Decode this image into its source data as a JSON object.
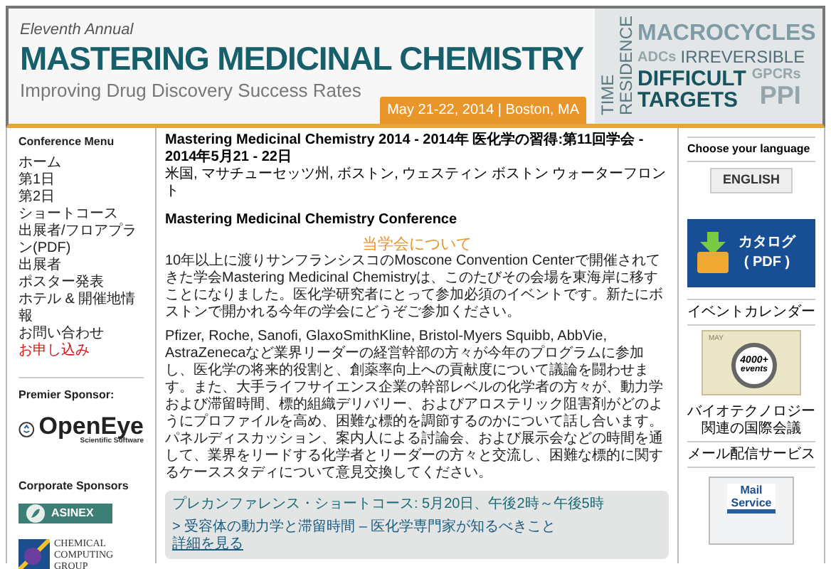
{
  "header": {
    "kicker": "Eleventh Annual",
    "title": "MASTERING MEDICINAL CHEMISTRY",
    "subtitle": "Improving Drug Discovery Success Rates",
    "date": "May 21-22, 2014 | Boston, MA",
    "vertical_words": [
      "RESIDENCE",
      "TIME"
    ],
    "tags": [
      {
        "text": "MACROCYCLES",
        "kind": "large"
      },
      {
        "text": "ADCs",
        "kind": "faint"
      },
      {
        "text": "IRREVERSIBLE",
        "kind": "medium"
      },
      {
        "text": "DIFFICULT",
        "kind": "dark"
      },
      {
        "text": "GPCRs",
        "kind": "faint"
      },
      {
        "text": "TARGETS",
        "kind": "dark"
      },
      {
        "text": "PPI",
        "kind": "faintlarge"
      }
    ]
  },
  "menu": {
    "title": "Conference Menu",
    "items": [
      {
        "label": "ホーム",
        "highlight": false
      },
      {
        "label": "第1日",
        "highlight": false
      },
      {
        "label": "第2日",
        "highlight": false
      },
      {
        "label": "ショートコース",
        "highlight": false
      },
      {
        "label": "出展者/フロアプラン(PDF)",
        "highlight": false
      },
      {
        "label": "出展者",
        "highlight": false
      },
      {
        "label": "ポスター発表",
        "highlight": false
      },
      {
        "label": "ホテル & 開催地情報",
        "highlight": false
      },
      {
        "label": "お問い合わせ",
        "highlight": false
      },
      {
        "label": "お申し込み",
        "highlight": true
      }
    ]
  },
  "premier_sponsor": {
    "title": "Premier Sponsor:",
    "logo": {
      "name": "OpenEye",
      "tagline": "Scientific Software"
    }
  },
  "corporate_sponsors": {
    "title": "Corporate Sponsors",
    "logos": [
      {
        "name": "ASINEX",
        "kind": "asinex"
      },
      {
        "name": "CHEMICAL COMPUTING GROUP",
        "kind": "ccg"
      }
    ]
  },
  "main": {
    "heading_line1": "Mastering Medicinal Chemistry 2014 - 2014年 医化学の習得:第11回学会 -",
    "heading_line2": "2014年5月21 - 22日",
    "venue": "米国, マサチューセッツ州, ボストン, ウェスティン ボストン ウォーターフロント",
    "conference": "Mastering Medicinal Chemistry Conference",
    "about_title": "当学会について",
    "paragraphs": [
      "10年以上に渡りサンフランシスコのMoscone Convention Centerで開催されてきた学会Mastering Medicinal Chemistryは、このたびその会場を東海岸に移すことになりました。医化学研究者にとって参加必須のイベントです。新たにボストンで開かれる今年の学会にどうぞご参加ください。",
      "Pfizer, Roche, Sanofi, GlaxoSmithKline, Bristol-Myers Squibb, AbbVie, AstraZenecaなど業界リーダーの経営幹部の方々が今年のプログラムに参加し、医化学の将来的役割と、創薬率向上への貢献度について議論を闘わせます。また、大手ライフサイエンス企業の幹部レベルの化学者の方々が、動力学および滞留時間、標的組織デリバリー、およびアロステリック阻害剤がどのようにプロファイルを高め、困難な標的を調節するのかについて話し合います。パネルディスカッション、案内人による討論会、および展示会などの時間を通して、業界をリードする化学者とリーダーの方々と交流し、困難な標的に関するケーススタディについて意見交換してください。"
    ],
    "short_course": {
      "title": "プレカンファレンス・ショートコース: 5月20日、午後2時～午後5時",
      "item": "> 受容体の動力学と滞留時間 – 医化学専門家が知るべきこと",
      "link": "詳細を見る"
    }
  },
  "right": {
    "language_title": "Choose your language",
    "language_button": "ENGLISH",
    "catalog_button": {
      "line1": "カタログ",
      "line2": "( PDF )"
    },
    "calendar_title": "イベントカレンダー",
    "calendar_image": {
      "month": "MAY",
      "badge_line1": "4000+",
      "badge_line2": "events"
    },
    "calendar_caption": "バイオテクノロジー関連の国際会議",
    "mail_title": "メール配信サービス",
    "mail_image": {
      "line1": "Mail",
      "line2": "Service"
    }
  }
}
